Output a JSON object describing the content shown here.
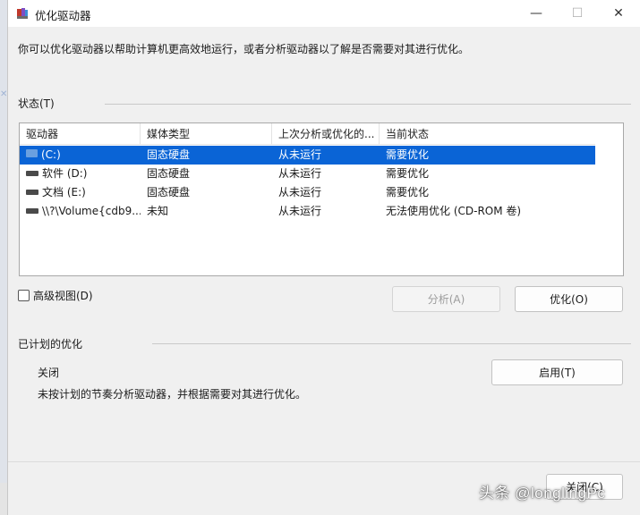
{
  "window": {
    "title": "优化驱动器",
    "minimize_glyph": "—",
    "maximize_glyph": "☐",
    "close_glyph": "✕"
  },
  "intro_text": "你可以优化驱动器以帮助计算机更高效地运行，或者分析驱动器以了解是否需要对其进行优化。",
  "status": {
    "group_label": "状态(T)",
    "columns": [
      "驱动器",
      "媒体类型",
      "上次分析或优化的...",
      "当前状态"
    ],
    "drives": [
      {
        "name": "(C:)",
        "media": "固态硬盘",
        "last_run": "从未运行",
        "state": "需要优化",
        "icon": "system-drive-icon",
        "selected": true
      },
      {
        "name": "软件 (D:)",
        "media": "固态硬盘",
        "last_run": "从未运行",
        "state": "需要优化",
        "icon": "drive-icon",
        "selected": false
      },
      {
        "name": "文档 (E:)",
        "media": "固态硬盘",
        "last_run": "从未运行",
        "state": "需要优化",
        "icon": "drive-icon",
        "selected": false
      },
      {
        "name": "\\\\?\\Volume{cdb9...",
        "media": "未知",
        "last_run": "从未运行",
        "state": "无法使用优化 (CD-ROM 卷)",
        "icon": "drive-icon",
        "selected": false
      }
    ],
    "advanced_view_label": "高级视图(D)",
    "analyze_button": "分析(A)",
    "optimize_button": "优化(O)"
  },
  "scheduled": {
    "group_label": "已计划的优化",
    "status": "关闭",
    "description": "未按计划的节奏分析驱动器，并根据需要对其进行优化。",
    "enable_button": "启用(T)"
  },
  "close_button": "关闭(C)",
  "watermark": "头条 @longlingPc",
  "colors": {
    "selection": "#0a64d6",
    "window_bg": "#f0f0f0"
  }
}
